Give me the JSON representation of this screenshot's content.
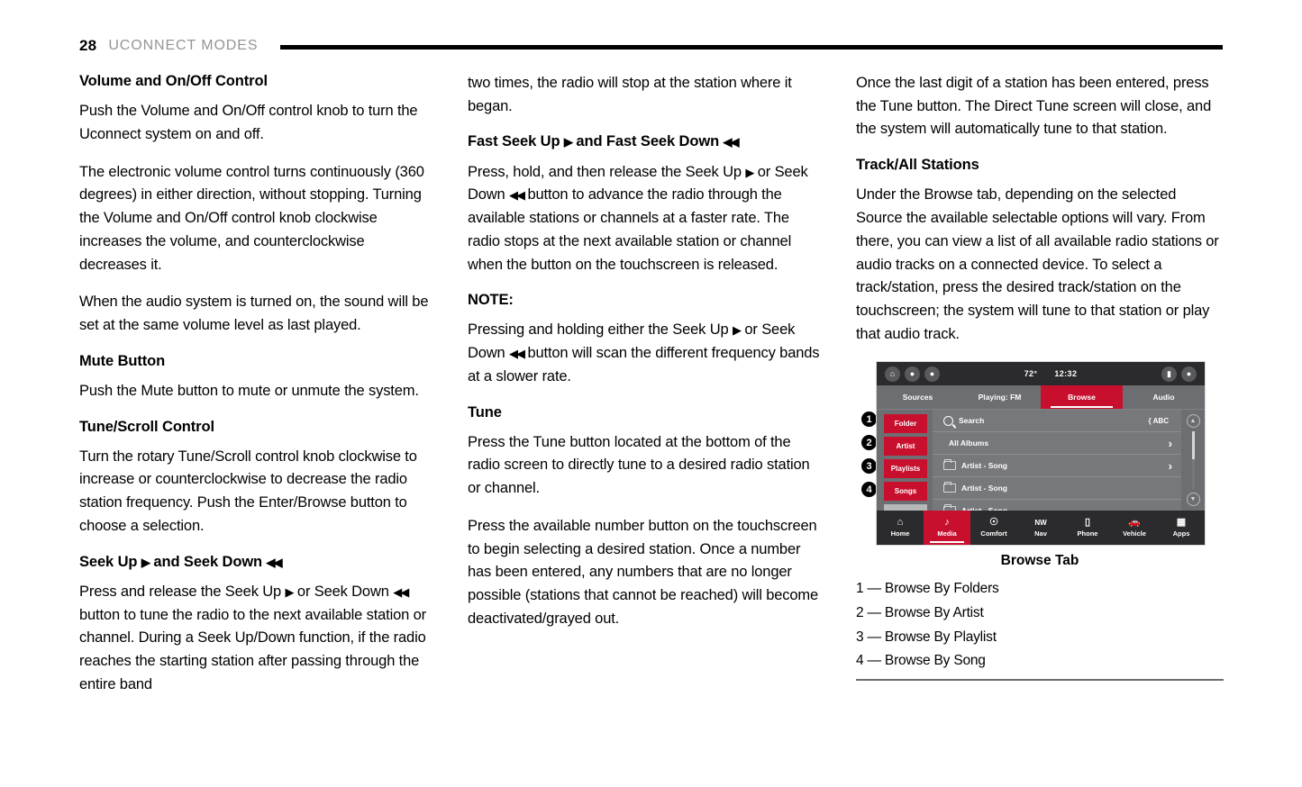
{
  "header": {
    "page_number": "28",
    "title": "UCONNECT MODES"
  },
  "columns": {
    "left": {
      "h1": "Volume and On/Off Control",
      "p1": "Push the Volume and On/Off control knob to turn the Uconnect system on and off.",
      "p2": "The electronic volume control turns continuously (360 degrees) in either direction, without stopping. Turning the Volume and On/Off control knob clockwise increases the volume, and counterclockwise decreases it.",
      "p3": "When the audio system is turned on, the sound will be set at the same volume level as last played.",
      "h2": "Mute Button",
      "p4": "Push the Mute button to mute or unmute the system.",
      "h3": "Tune/Scroll Control",
      "p5": "Turn the rotary Tune/Scroll control knob clockwise to increase or counterclockwise to decrease the radio station frequency. Push the Enter/Browse button to choose a selection.",
      "h4_part1": "Seek Up",
      "h4_part2": "and Seek Down",
      "p6_part1": "Press and release the Seek Up",
      "p6_part2": "or Seek Down",
      "p6_part3": "button to tune the radio to the next available station or channel. During a Seek Up/Down function, if the radio reaches the starting station after passing through the entire band"
    },
    "middle": {
      "p1": "two times, the radio will stop at the station where it began.",
      "h1_part1": "Fast Seek Up",
      "h1_part2": "and Fast Seek Down",
      "p2_part1": "Press, hold, and then release the Seek Up",
      "p2_part2": "or Seek Down",
      "p2_part3": "button to advance the radio through the available stations or channels at a faster rate. The radio stops at the next available station or channel when the button on the touchscreen is released.",
      "h2": "NOTE:",
      "p3_part1": "Pressing and holding either the Seek Up",
      "p3_part2": "or Seek Down",
      "p3_part3": "button will scan the different frequency bands at a slower rate.",
      "h3": "Tune",
      "p4": "Press the Tune button located at the bottom of the radio screen to directly tune to a desired radio station or channel.",
      "p5": "Press the available number button on the touchscreen to begin selecting a desired station. Once a number has been entered, any numbers that are no longer possible (stations that cannot be reached) will become deactivated/grayed out."
    },
    "right": {
      "p1": "Once the last digit of a station has been entered, press the Tune button. The Direct Tune screen will close, and the system will automatically tune to that station.",
      "h1": "Track/All Stations",
      "p2": "Under the Browse tab, depending on the selected Source the available selectable options will vary. From there, you can view a list of all available radio stations or audio tracks on a connected device. To select a track/station, press the desired track/station on the touchscreen; the system will tune to that station or play that audio track."
    }
  },
  "figure": {
    "caption": "Browse Tab",
    "callouts": [
      "1",
      "2",
      "3",
      "4"
    ],
    "legend": [
      "1 — Browse By Folders",
      "2 — Browse By Artist",
      "3 — Browse By Playlist",
      "4 — Browse By Song"
    ],
    "screen": {
      "status_bar": {
        "left_icons": [
          "home-icon",
          "driver-seat-icon",
          "passenger-seat-icon"
        ],
        "temperature": "72°",
        "time": "12:32",
        "right_icons": [
          "media-icon",
          "volume-icon"
        ]
      },
      "tabs": [
        {
          "label": "Sources",
          "active": false
        },
        {
          "label": "Playing: FM",
          "active": false
        },
        {
          "label": "Browse",
          "active": true
        },
        {
          "label": "Audio",
          "active": false
        }
      ],
      "side_buttons": [
        "Folder",
        "Artist",
        "Playlists",
        "Songs"
      ],
      "side_more_icon": "chevron-down-icon",
      "list": [
        {
          "type": "search",
          "label": "Search",
          "right": "ABC"
        },
        {
          "type": "item",
          "label": "All Albums",
          "right": "chevron-right-icon"
        },
        {
          "type": "folder",
          "label": "Artist - Song",
          "right": "chevron-right-icon"
        },
        {
          "type": "folder",
          "label": "Artist - Song",
          "right": ""
        },
        {
          "type": "folder",
          "label": "Artist - Song",
          "right": ""
        }
      ],
      "scroll": {
        "up": "▲",
        "down": "▼"
      },
      "bottom_nav": [
        {
          "label": "Home",
          "icon": "home-icon",
          "active": false
        },
        {
          "label": "Media",
          "icon": "music-note-icon",
          "active": true
        },
        {
          "label": "Comfort",
          "icon": "climate-icon",
          "active": false
        },
        {
          "label": "Nav",
          "icon": "compass-nw-icon",
          "active": false
        },
        {
          "label": "Phone",
          "icon": "phone-icon",
          "active": false
        },
        {
          "label": "Vehicle",
          "icon": "car-icon",
          "active": false
        },
        {
          "label": "Apps",
          "icon": "grid-icon",
          "active": false
        }
      ]
    },
    "colors": {
      "accent_red": "#c8102e",
      "screen_dark": "#2b2b2d",
      "screen_gray": "#6d6e71"
    }
  }
}
